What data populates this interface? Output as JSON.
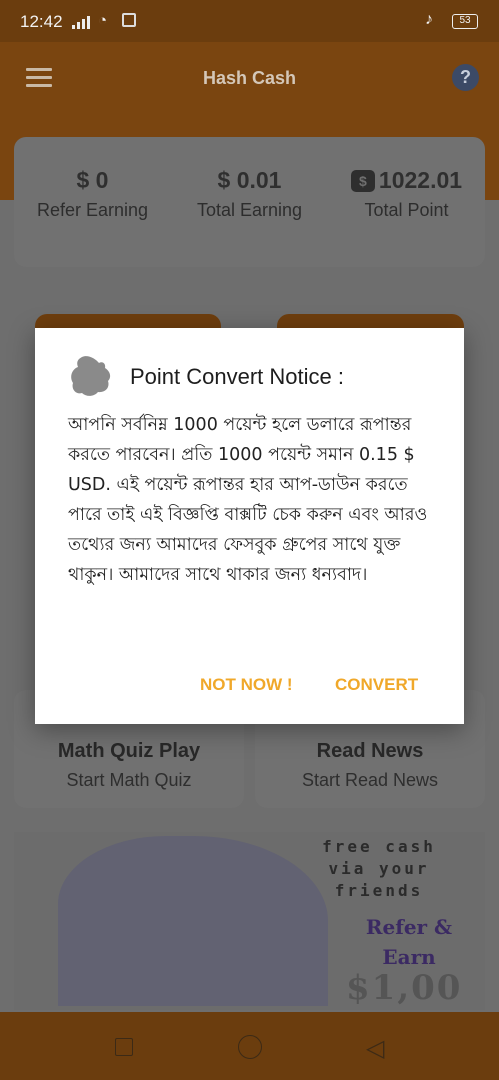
{
  "status_bar": {
    "time": "12:42",
    "battery": "53"
  },
  "app_bar": {
    "title": "Hash Cash",
    "help_icon": "?"
  },
  "stats": [
    {
      "value": "$ 0",
      "label": "Refer Earning"
    },
    {
      "value": "$ 0.01",
      "label": "Total Earning"
    },
    {
      "value": "1022.01",
      "label": "Total Point"
    }
  ],
  "tiles": [
    {
      "title": "Math Quiz Play",
      "subtitle": "Start Math Quiz"
    },
    {
      "title": "Read News",
      "subtitle": "Start Read News"
    }
  ],
  "banner": {
    "line1": "free cash",
    "line2": "via your",
    "line3": "friends",
    "refer": "Refer &",
    "earn": "Earn",
    "amount": "$1,00"
  },
  "dialog": {
    "title": "Point Convert Notice :",
    "body": "আপনি সর্বনিম্ন 1000 পয়েন্ট হলে ডলারে রূপান্তর করতে পারবেন। প্রতি 1000 পয়েন্ট সমান 0.15 $ USD. এই পয়েন্ট রূপান্তর হার আপ-ডাউন করতে পারে তাই এই বিজ্ঞপ্তি বাক্সটি চেক করুন এবং আরও তথ্যের জন্য আমাদের ফেসবুক গ্রুপের সাথে যুক্ত থাকুন। আমাদের সাথে থাকার জন্য ধন্যবাদ।",
    "cancel_label": "NOT NOW !",
    "confirm_label": "CONVERT"
  },
  "colors": {
    "accent": "#f0a82a",
    "app_bar": "#7a4510"
  }
}
